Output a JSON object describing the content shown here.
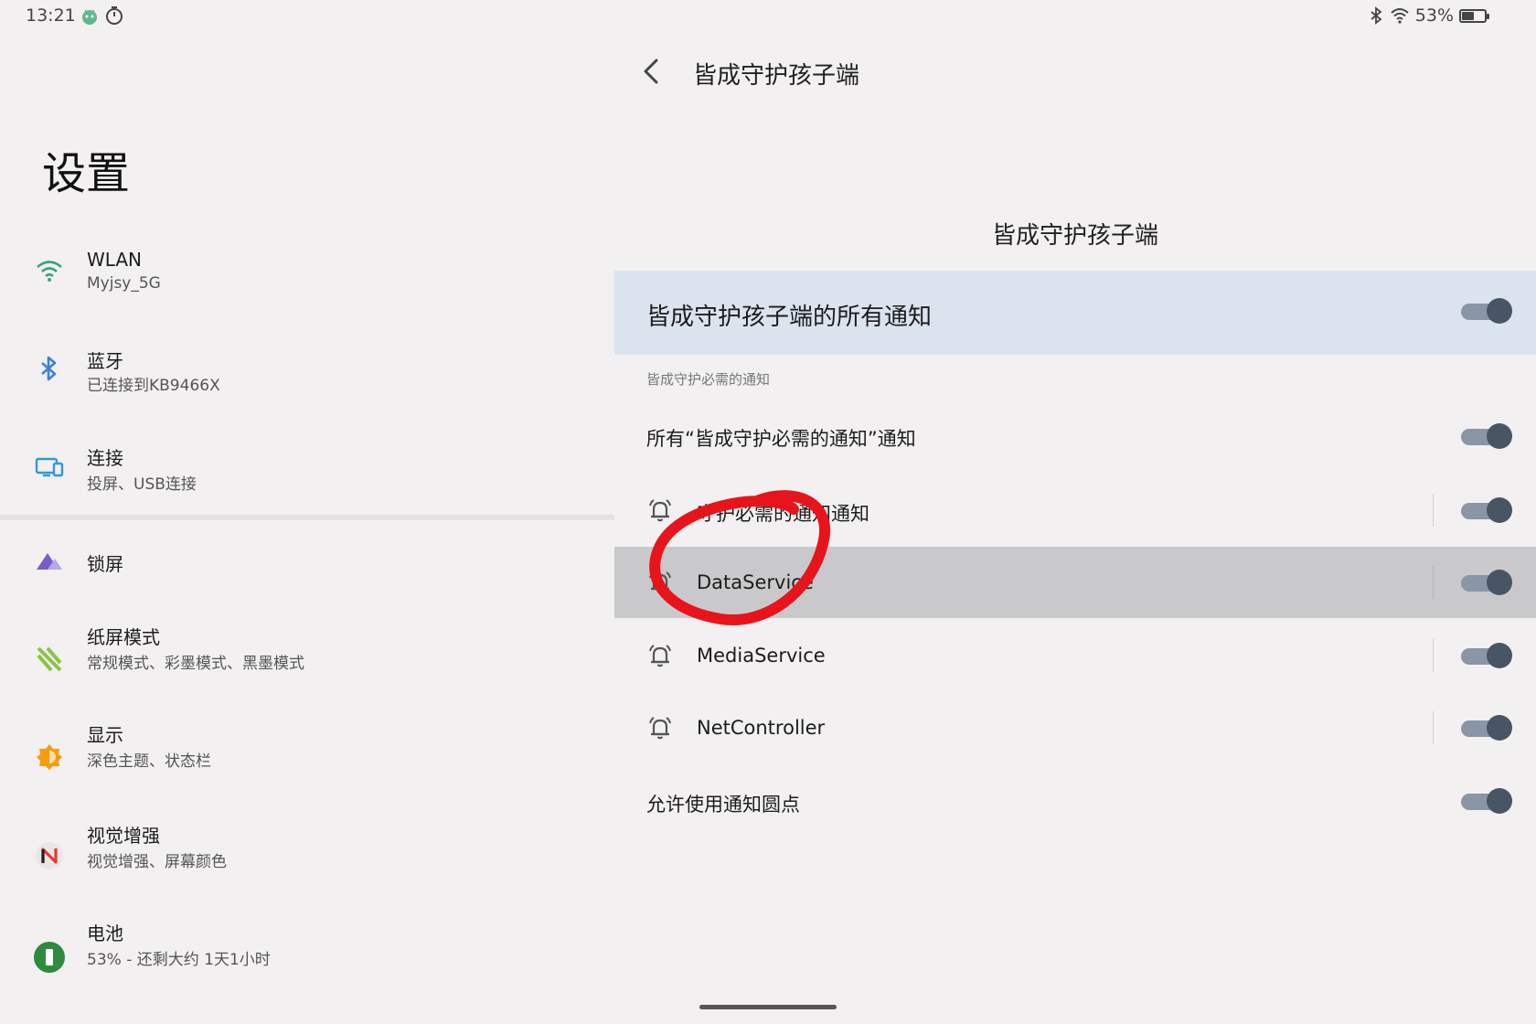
{
  "status_bar": {
    "time": "13:21",
    "battery_percent": "53%",
    "battery_level": 0.53
  },
  "left_pane": {
    "title": "设置",
    "items": [
      {
        "label": "WLAN",
        "sub": "Myjsy_5G"
      },
      {
        "label": "蓝牙",
        "sub": "已连接到KB9466X"
      },
      {
        "label": "连接",
        "sub": "投屏、USB连接"
      },
      {
        "label": "锁屏",
        "sub": ""
      },
      {
        "label": "纸屏模式",
        "sub": "常规模式、彩墨模式、黑墨模式"
      },
      {
        "label": "显示",
        "sub": "深色主题、状态栏"
      },
      {
        "label": "视觉增强",
        "sub": "视觉增强、屏幕颜色"
      },
      {
        "label": "电池",
        "sub": "53% - 还剩大约 1天1小时"
      }
    ]
  },
  "right_pane": {
    "header_title": "皆成守护孩子端",
    "section_title": "皆成守护孩子端",
    "master_toggle": {
      "label": "皆成守护孩子端的所有通知",
      "on": true
    },
    "group_label": "皆成守护必需的通知",
    "rows": [
      {
        "label": "所有“皆成守护必需的通知”通知",
        "on": true
      },
      {
        "label": "守护必需的通知通知",
        "on": true
      },
      {
        "label": "DataService",
        "on": true
      },
      {
        "label": "MediaService",
        "on": true
      },
      {
        "label": "NetController",
        "on": true
      },
      {
        "label": "允许使用通知圆点",
        "on": true
      }
    ]
  },
  "colors": {
    "background": "#f2f0f1",
    "master_row_bg": "#dbe3ef",
    "highlight_row_bg": "#c9c9cb",
    "toggle_track": "#8a95a5",
    "toggle_thumb": "#485564",
    "annotation_red": "#e8141c"
  }
}
